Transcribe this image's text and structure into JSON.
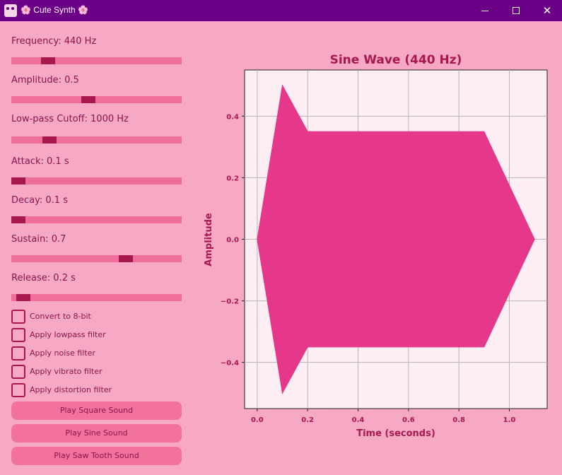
{
  "window": {
    "title": "🌸 Cute Synth 🌸",
    "controls": {
      "minimize": "—",
      "maximize": "☐",
      "close": "✕"
    },
    "colors": {
      "titlebar": "#6b0087",
      "background": "#f7a8c4",
      "accent": "#a8184f"
    }
  },
  "sliders": [
    {
      "label": "Frequency: 440 Hz",
      "fraction": 0.19
    },
    {
      "label": "Amplitude: 0.5",
      "fraction": 0.45
    },
    {
      "label": "Low-pass Cutoff: 1000 Hz",
      "fraction": 0.2
    },
    {
      "label": "Attack: 0.1 s",
      "fraction": 0.0
    },
    {
      "label": "Decay: 0.1 s",
      "fraction": 0.0
    },
    {
      "label": "Sustain: 0.7",
      "fraction": 0.69
    },
    {
      "label": "Release: 0.2 s",
      "fraction": 0.03
    }
  ],
  "checkboxes": [
    {
      "label": "Convert to 8-bit",
      "checked": false
    },
    {
      "label": "Apply lowpass filter",
      "checked": false
    },
    {
      "label": "Apply noise filter",
      "checked": false
    },
    {
      "label": "Apply vibrato filter",
      "checked": false
    },
    {
      "label": "Apply distortion filter",
      "checked": false
    }
  ],
  "buttons": {
    "square": "Play Square Sound",
    "sine": "Play Sine Sound",
    "saw": "Play Saw Tooth Sound"
  },
  "chart_data": {
    "type": "area",
    "title": "Sine Wave (440 Hz)",
    "xlabel": "Time (seconds)",
    "ylabel": "Amplitude",
    "xlim": [
      -0.05,
      1.15
    ],
    "ylim": [
      -0.55,
      0.55
    ],
    "xticks": [
      0.0,
      0.2,
      0.4,
      0.6,
      0.8,
      1.0
    ],
    "xtick_labels": [
      "0.0",
      "0.2",
      "0.4",
      "0.6",
      "0.8",
      "1.0"
    ],
    "yticks": [
      -0.4,
      -0.2,
      0.0,
      0.2,
      0.4
    ],
    "ytick_labels": [
      "−0.4",
      "−0.2",
      "0.0",
      "0.2",
      "0.4"
    ],
    "grid": true,
    "fill_color": "#e5388a",
    "envelope": {
      "t": [
        0.0,
        0.1,
        0.2,
        0.9,
        1.1
      ],
      "amplitude": [
        0.0,
        0.5,
        0.35,
        0.35,
        0.0
      ]
    }
  }
}
